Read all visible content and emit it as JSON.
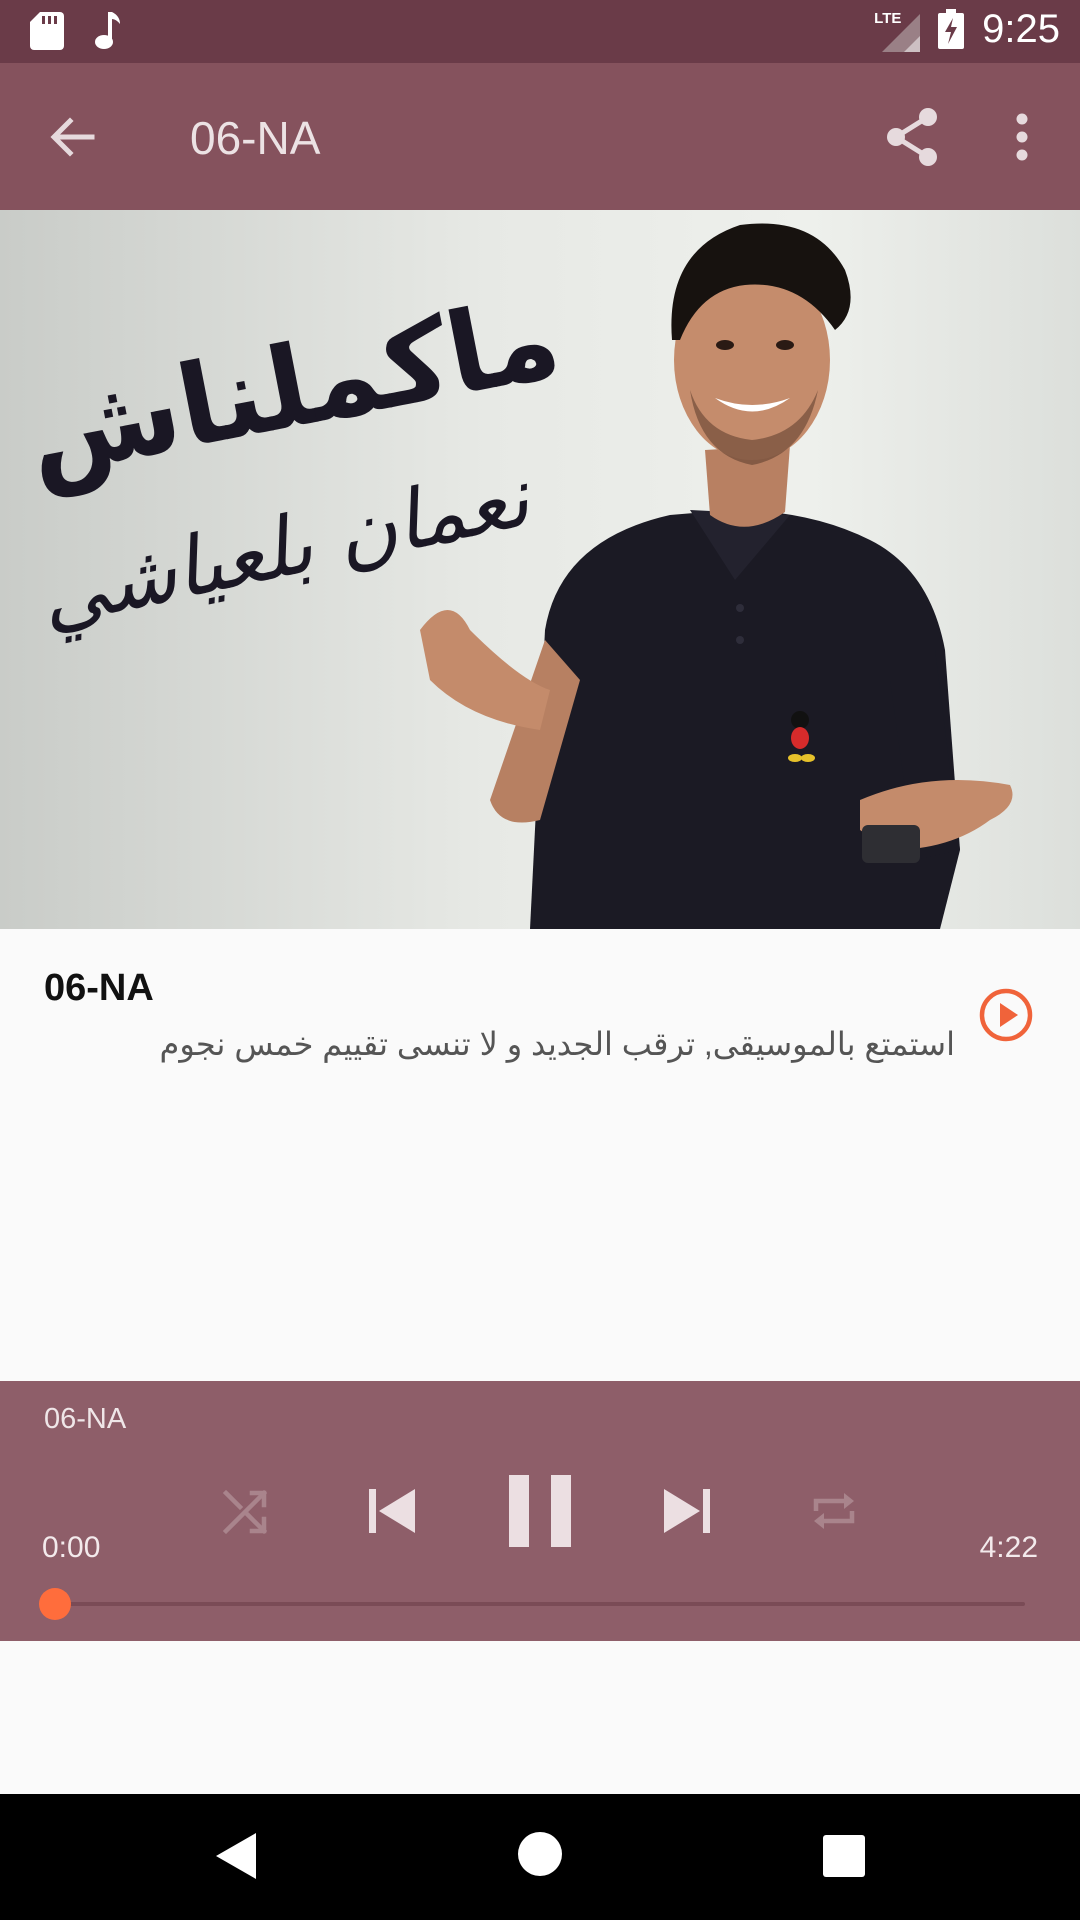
{
  "status_bar": {
    "time": "9:25",
    "network": "LTE",
    "icons": [
      "sd-card-icon",
      "music-note-icon",
      "signal-icon",
      "battery-charging-icon"
    ]
  },
  "app_bar": {
    "title": "06-NA",
    "icons": [
      "back-arrow-icon",
      "share-icon",
      "more-vert-icon"
    ]
  },
  "album_art": {
    "title_calligraphy": "ماكملناش",
    "artist_calligraphy": "نعمان بلعياشي"
  },
  "track": {
    "title": "06-NA",
    "description": "استمتع بالموسيقى, ترقب الجديد و لا تنسى تقييم خمس نجوم"
  },
  "player": {
    "track_name": "06-NA",
    "current_time": "0:00",
    "total_time": "4:22",
    "progress": 0,
    "icons": [
      "shuffle-icon",
      "skip-previous-icon",
      "pause-icon",
      "skip-next-icon",
      "repeat-icon"
    ]
  },
  "colors": {
    "status_bar": "#6a3b48",
    "app_bar": "#85525d",
    "player_panel": "#8e5e69",
    "accent": "#ff6d3c"
  }
}
